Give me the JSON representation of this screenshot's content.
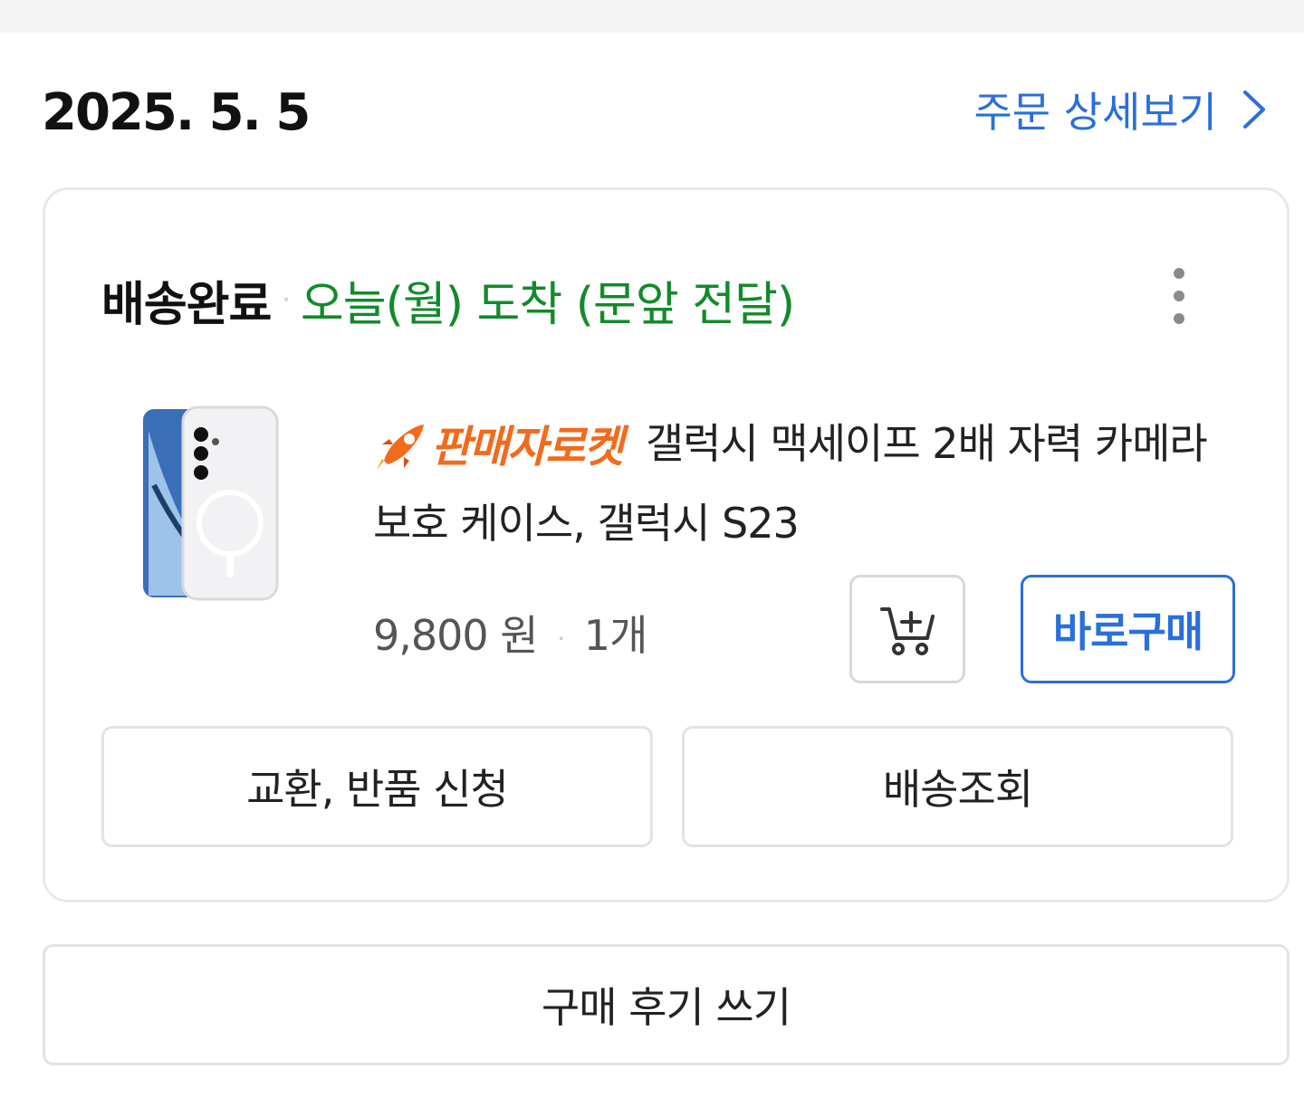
{
  "order": {
    "date": "2025. 5. 5",
    "detail_link_label": "주문 상세보기",
    "detail_link_icon": "chevron-right-icon"
  },
  "shipment": {
    "status": "배송완료",
    "separator": "·",
    "arrival_text": "오늘(월) 도착 (문앞 전달)",
    "more_icon": "more-vertical-icon"
  },
  "product": {
    "badge_icon": "rocket-icon",
    "badge_label": "판매자로켓",
    "name": "갤럭시 맥세이프 2배 자력 카메라 보호 케이스, 갤럭시 S23",
    "price": "9,800 원",
    "separator": "·",
    "quantity": "1개",
    "image_icon": "phone-case-image"
  },
  "actions": {
    "cart_icon": "add-to-cart-icon",
    "buy_now_label": "바로구매",
    "exchange_return_label": "교환, 반품 신청",
    "track_delivery_label": "배송조회",
    "write_review_label": "구매 후기 쓰기"
  },
  "colors": {
    "link_blue": "#2a6fdb",
    "status_green": "#138a2a",
    "badge_orange": "#f26a1b"
  }
}
